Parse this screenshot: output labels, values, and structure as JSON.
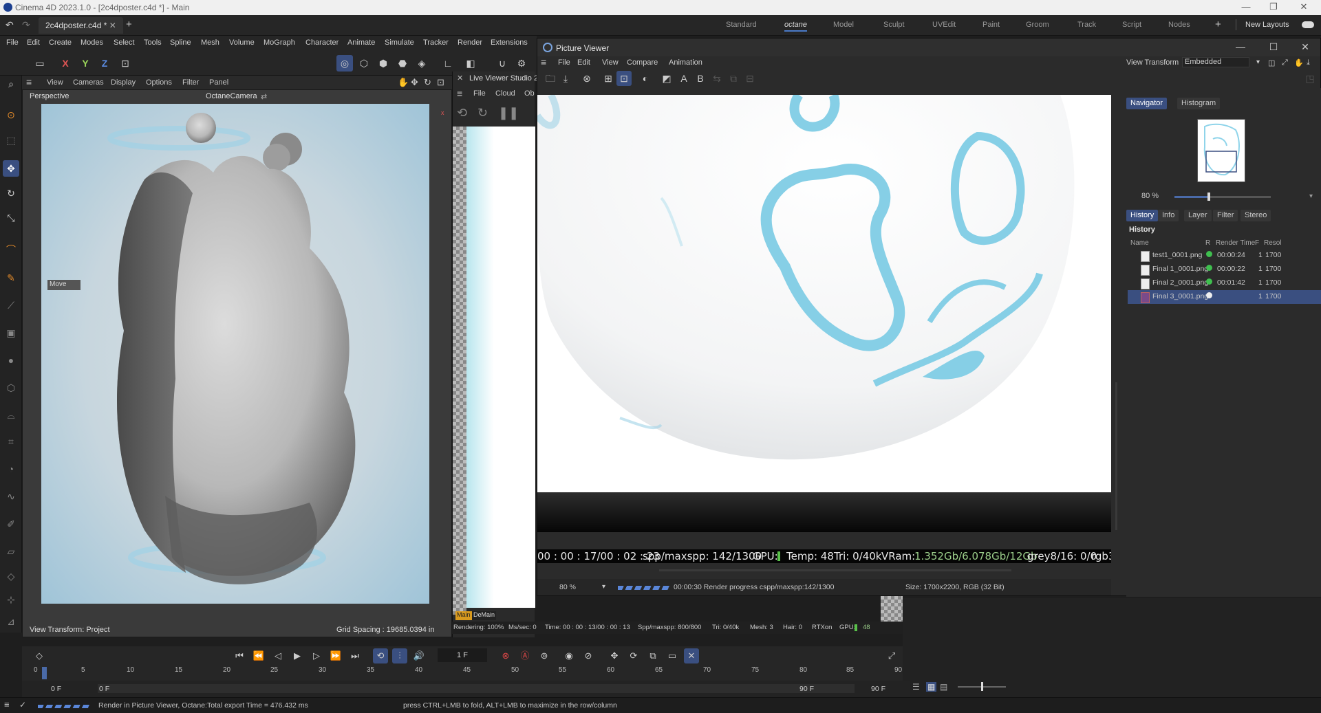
{
  "window": {
    "title": "Cinema 4D 2023.1.0 - [2c4dposter.c4d *] - Main"
  },
  "tabs": {
    "document": "2c4dposter.c4d *",
    "layouts": [
      "Standard",
      "octane",
      "Model",
      "Sculpt",
      "UVEdit",
      "Paint",
      "Groom",
      "Track",
      "Script",
      "Nodes"
    ],
    "active_layout": "octane",
    "new_layouts": "New Layouts"
  },
  "menu": [
    "File",
    "Edit",
    "Create",
    "Modes",
    "Select",
    "Tools",
    "Spline",
    "Mesh",
    "Volume",
    "MoGraph",
    "Character",
    "Animate",
    "Simulate",
    "Tracker",
    "Render",
    "Extensions"
  ],
  "toolbar": {
    "x": "X",
    "y": "Y",
    "z": "Z"
  },
  "viewport": {
    "menu": [
      "View",
      "Cameras",
      "Display",
      "Options",
      "Filter",
      "Panel"
    ],
    "name": "Perspective",
    "camera": "OctaneCamera",
    "move_label": "Move",
    "view_transform": "View Transform: Project",
    "grid_spacing": "Grid Spacing : 19685.0394 in"
  },
  "live_viewer": {
    "title": "Live Viewer Studio 2",
    "menu": [
      "File",
      "Cloud",
      "Ob"
    ],
    "main_label": "Main",
    "demain_label": "DeMain"
  },
  "render_stats": {
    "rendering": "Rendering: 100%",
    "ms_sec": "Ms/sec: 0",
    "time": "Time: 00 : 00 : 13/00 : 00 : 13",
    "spp": "Spp/maxspp: 800/800",
    "tri": "Tri: 0/40k",
    "mesh": "Mesh: 3",
    "hair": "Hair: 0",
    "rtx": "RTXon",
    "gpu": "GPU:",
    "gpu_val": "48"
  },
  "picture_viewer": {
    "title": "Picture Viewer",
    "menu": [
      "File",
      "Edit",
      "View",
      "Compare",
      "Animation"
    ],
    "view_transform_label": "View Transform",
    "view_transform_value": "Embedded",
    "tool_a": "A",
    "tool_b": "B",
    "overlay": {
      "time": "00 : 00 : 17/00 : 02 : 23",
      "spp": "spp/maxspp: 142/1300",
      "gpu": "GPU:",
      "temp": "Temp: 48",
      "tri": "Tri: 0/40k",
      "vram_label": "VRam:",
      "vram": "1.352Gb/6.078Gb/12Gb",
      "grey": "grey8/16: 0/0",
      "rgb": "rgb3"
    },
    "zoom": "80 %",
    "progress_text": "00:00:30 Render progress  cspp/maxspp:142/1300",
    "size_text": "Size: 1700x2200, RGB (32 Bit)",
    "panel_tabs_top": [
      "Navigator",
      "Histogram"
    ],
    "nav_zoom": "80 %",
    "panel_tabs": [
      "History",
      "Info",
      "Layer",
      "Filter",
      "Stereo"
    ],
    "history_heading": "History",
    "columns": [
      "Name",
      "R",
      "Render Time",
      "F",
      "Resol"
    ],
    "rows": [
      {
        "name": "test1_0001.png",
        "time": "00:00:24",
        "f": "1",
        "res": "1700",
        "status": "#3fbf4f"
      },
      {
        "name": "Final 1_0001.png",
        "time": "00:00:22",
        "f": "1",
        "res": "1700",
        "status": "#3fbf4f"
      },
      {
        "name": "Final 2_0001.png",
        "time": "00:01:42",
        "f": "1",
        "res": "1700",
        "status": "#3fbf4f"
      },
      {
        "name": "Final 3_0001.png",
        "time": "",
        "f": "1",
        "res": "1700",
        "status": "#eeeeee"
      }
    ]
  },
  "timeline": {
    "current_frame": "1 F",
    "ruler": [
      "0",
      "5",
      "10",
      "15",
      "20",
      "25",
      "30",
      "35",
      "40",
      "45",
      "50",
      "55",
      "60",
      "65",
      "70",
      "75",
      "80",
      "85",
      "90"
    ],
    "start": "0 F",
    "start2": "0 F",
    "end": "90 F",
    "end2": "90 F"
  },
  "statusbar": {
    "left": "Render in Picture Viewer, Octane:Total export Time = 476.432 ms",
    "hint": "press CTRL+LMB to fold, ALT+LMB to maximize in the row/column"
  },
  "colors": {
    "accent": "#3a4f80",
    "render_blue": "#8fd4ea",
    "status_green": "#3fbf4f"
  }
}
